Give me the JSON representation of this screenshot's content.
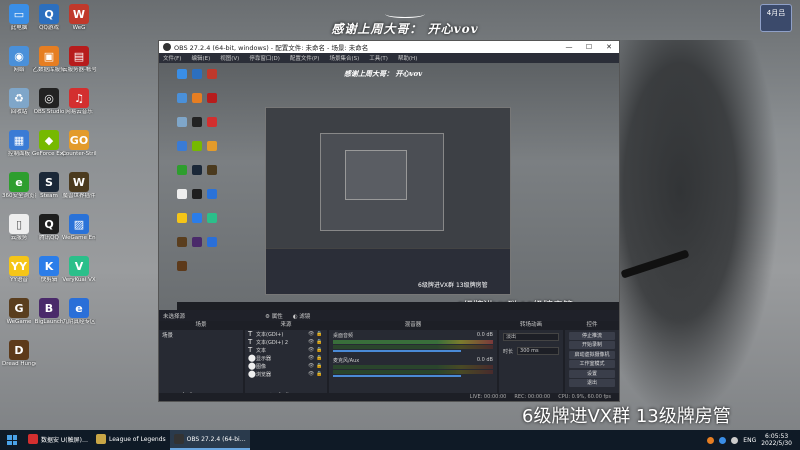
{
  "desktop": {
    "banner": "感谢上周大哥： 开心vov",
    "corner_badge": "4月吕",
    "caption": "6级牌进VX群  13级牌房管",
    "icons": [
      {
        "name": "computer",
        "label": "此电脑",
        "color": "#3a8ee6",
        "glyph": "▭"
      },
      {
        "name": "qq-browser",
        "label": "QQ游戏",
        "color": "#2c6fbe",
        "glyph": "Q"
      },
      {
        "name": "wegame",
        "label": "WeG",
        "color": "#c0392b",
        "glyph": "W"
      },
      {
        "name": "network",
        "label": "网络",
        "color": "#4a90d9",
        "glyph": "◉"
      },
      {
        "name": "tool-box",
        "label": "乙数据库服务",
        "color": "#e67e22",
        "glyph": "▣"
      },
      {
        "name": "red-book",
        "label": "云服务器-帐号",
        "color": "#b71c1c",
        "glyph": "▤"
      },
      {
        "name": "recycle-bin",
        "label": "回收站",
        "color": "#7fa6c9",
        "glyph": "♻"
      },
      {
        "name": "obs-studio",
        "label": "OBS Studio",
        "color": "#222",
        "glyph": "◎"
      },
      {
        "name": "netease",
        "label": "网易云音乐",
        "color": "#d32f2f",
        "glyph": "♫"
      },
      {
        "name": "control-panel",
        "label": "控制面板",
        "color": "#3a7bd5",
        "glyph": "▦"
      },
      {
        "name": "geforce",
        "label": "GeForce Experience",
        "color": "#76b900",
        "glyph": "◆"
      },
      {
        "name": "csgo",
        "label": "Counter-Strike Global Off...",
        "color": "#e39b2b",
        "glyph": "GO"
      },
      {
        "name": "ie-browser",
        "label": "360安全浏览器",
        "color": "#2e9e2e",
        "glyph": "e"
      },
      {
        "name": "steam",
        "label": "Steam",
        "color": "#1b2838",
        "glyph": "S"
      },
      {
        "name": "wow",
        "label": "魔兽世界插件",
        "color": "#4b3a1e",
        "glyph": "W"
      },
      {
        "name": "tencent-folder",
        "label": "云服务",
        "color": "#eee",
        "glyph": "▯"
      },
      {
        "name": "qq",
        "label": "腾讯QQ",
        "color": "#1e1e1e",
        "glyph": "Q"
      },
      {
        "name": "app-store",
        "label": "WeGame Engine",
        "color": "#2a72d8",
        "glyph": "▨"
      },
      {
        "name": "yy",
        "label": "YY语音",
        "color": "#f5c518",
        "glyph": "YY"
      },
      {
        "name": "kuaishou",
        "label": "快剪辑",
        "color": "#2b7de9",
        "glyph": "K"
      },
      {
        "name": "vpn",
        "label": "VeryKuai VX",
        "color": "#2bbf8a",
        "glyph": "V"
      },
      {
        "name": "league-client",
        "label": "WeGame",
        "color": "#5a3e1e",
        "glyph": "G"
      },
      {
        "name": "bilibili",
        "label": "BigLaunch",
        "color": "#4a2a6a",
        "glyph": "B"
      },
      {
        "name": "ie-old",
        "label": "九阴真经专区",
        "color": "#2a6fd8",
        "glyph": "e"
      },
      {
        "name": "dread-hunger",
        "label": "Dread Hunger",
        "color": "#5d3a1a",
        "glyph": "D"
      }
    ]
  },
  "obs": {
    "title": "OBS 27.2.4 (64-bit, windows) - 配置文件: 未命名 - 场景: 未命名",
    "menu": [
      "文件(F)",
      "编辑(E)",
      "视图(V)",
      "停靠窗口(D)",
      "配置文件(P)",
      "场景集合(S)",
      "工具(T)",
      "帮助(H)"
    ],
    "preview_banner": "感谢上周大哥： 开心vov",
    "nested_caption": "6级牌进VX群  13级牌房管",
    "preview_caption": "6级牌进VX群  13级牌房管",
    "scene_bar": {
      "label": "未选择源",
      "props": "属性",
      "filters": "滤镜"
    },
    "docks": {
      "scenes": {
        "header": "场景",
        "items": [
          "场景"
        ]
      },
      "sources": {
        "header": "来源",
        "items": [
          {
            "type": "T",
            "name": "文本(GDI+)"
          },
          {
            "type": "T",
            "name": "文本(GDI+) 2"
          },
          {
            "type": "T",
            "name": "文本"
          },
          {
            "type": "⬤",
            "name": "显示器"
          },
          {
            "type": "⬤",
            "name": "图像"
          },
          {
            "type": "⬤",
            "name": "浏览器"
          }
        ]
      },
      "mixer": {
        "header": "混音器",
        "channels": [
          {
            "name": "桌面音频",
            "db": "0.0 dB"
          },
          {
            "name": "麦克风/Aux",
            "db": "0.0 dB"
          }
        ]
      },
      "transitions": {
        "header": "转场动画",
        "type": "淡出",
        "duration_label": "时长",
        "duration": "300 ms"
      },
      "controls": {
        "header": "控件",
        "buttons": [
          "停止推流",
          "开始录制",
          "启动虚拟摄像机",
          "工作室模式",
          "设置",
          "退出"
        ]
      }
    },
    "status": {
      "live": "LIVE: 00:00:00",
      "rec": "REC: 00:00:00",
      "cpu": "CPU: 0.9%, 60.00 fps"
    }
  },
  "taskbar": {
    "items": [
      {
        "name": "netease-music",
        "label": "数据安 U(触屏)…",
        "color": "#d32f2f",
        "active": false
      },
      {
        "name": "league-of-legends",
        "label": "League of Legends",
        "color": "#c9a646",
        "active": false
      },
      {
        "name": "obs",
        "label": "OBS 27.2.4 (64-bi…",
        "color": "#333",
        "active": true
      }
    ],
    "tray_lang": "ENG",
    "time": "6:05:53",
    "date": "2022/5/30"
  }
}
